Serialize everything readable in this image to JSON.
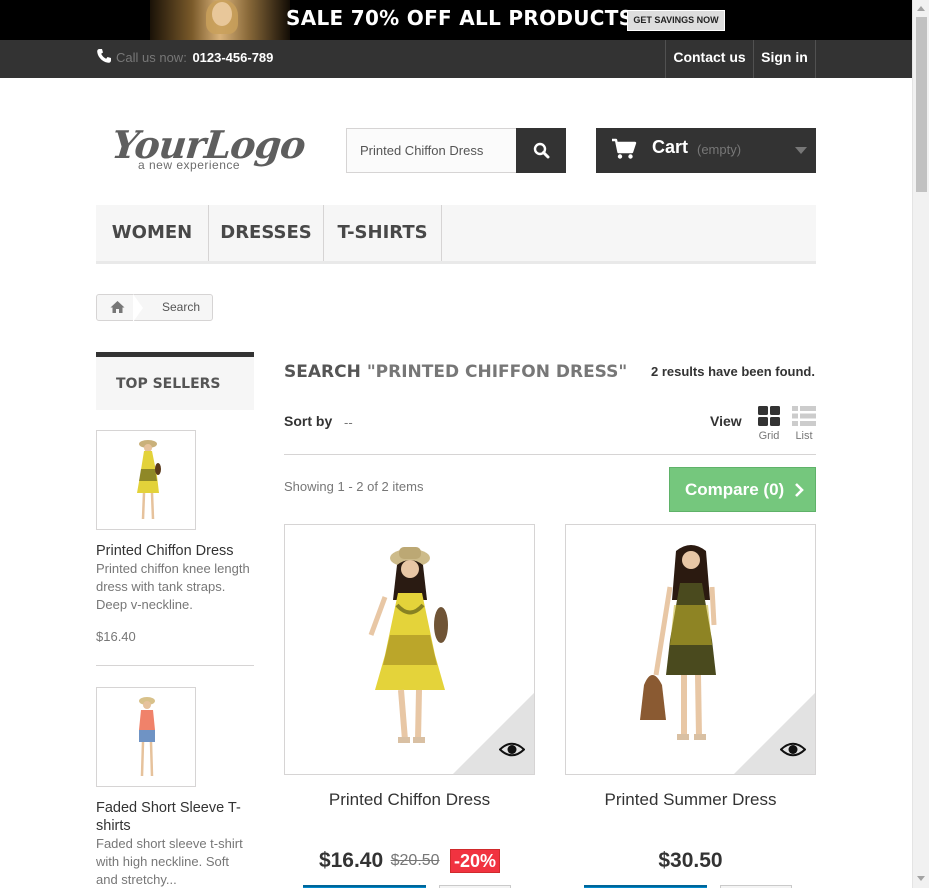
{
  "promo": {
    "text": "SALE 70% OFF ALL PRODUCTS",
    "button": "GET SAVINGS NOW"
  },
  "nav": {
    "call_label": "Call us now:",
    "phone": "0123-456-789",
    "contact": "Contact us",
    "signin": "Sign in"
  },
  "logo": {
    "main": "YourLogo",
    "sub": "a new experience"
  },
  "search": {
    "value": "Printed Chiffon Dress",
    "icon": "search-icon"
  },
  "cart": {
    "label": "Cart",
    "status": "(empty)"
  },
  "menu": {
    "items": [
      "WOMEN",
      "DRESSES",
      "T-SHIRTS"
    ]
  },
  "breadcrumb": {
    "current": "Search",
    "icon": "home-icon"
  },
  "sidebar": {
    "heading": "TOP SELLERS",
    "products": [
      {
        "name": "Printed Chiffon Dress",
        "desc": "Printed chiffon knee length dress with tank straps. Deep v-neckline.",
        "price": "$16.40"
      },
      {
        "name": "Faded Short Sleeve T-shirts",
        "desc": "Faded short sleeve t-shirt with high neckline. Soft and stretchy...",
        "price": ""
      }
    ]
  },
  "main": {
    "title": "SEARCH",
    "query": "\"PRINTED CHIFFON DRESS\"",
    "results": "2 results have been found.",
    "sort_label": "Sort by",
    "sort_value": "--",
    "view_label": "View",
    "view_grid": "Grid",
    "view_list": "List",
    "showing": "Showing 1 - 2 of 2 items",
    "compare": "Compare (0)"
  },
  "products": [
    {
      "name": "Printed Chiffon Dress",
      "price": "$16.40",
      "old_price": "$20.50",
      "reduction": "-20%"
    },
    {
      "name": "Printed Summer Dress",
      "price": "$30.50",
      "old_price": "",
      "reduction": ""
    }
  ],
  "colors": {
    "dark": "#333333",
    "compare_green": "#75c77d",
    "sale_red": "#f13340",
    "button_blue": "#0088cc"
  }
}
